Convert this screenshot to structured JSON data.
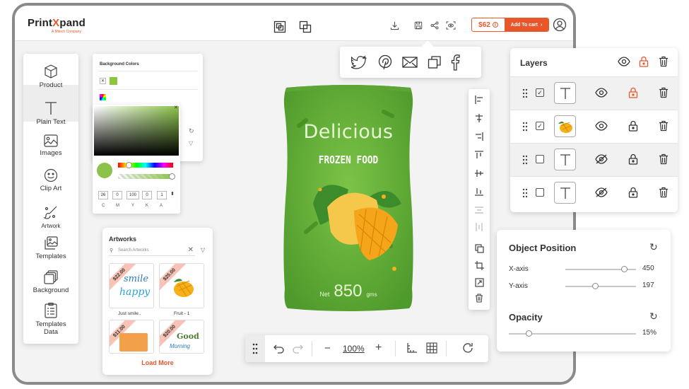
{
  "brand": {
    "name_part1": "Print",
    "name_part2": "X",
    "name_part3": "pand",
    "tagline": "A Mitech Company"
  },
  "header": {
    "price": "$62",
    "add_to_cart": "Add To cart"
  },
  "sidebar": {
    "items": [
      {
        "label": "Product",
        "icon": "cube-icon"
      },
      {
        "label": "Plain Text",
        "icon": "text-icon"
      },
      {
        "label": "Images",
        "icon": "image-icon"
      },
      {
        "label": "Clip Art",
        "icon": "smiley-icon"
      },
      {
        "label": "Artwork",
        "icon": "brush-icon"
      },
      {
        "label": "Templates",
        "icon": "templates-icon"
      },
      {
        "label": "Background",
        "icon": "background-icon"
      },
      {
        "label": "Templates",
        "label2": "Data",
        "icon": "list-icon"
      }
    ]
  },
  "color_panel": {
    "title": "Background Colors",
    "swatch": "#8cc63f",
    "current_color": "#8bc34a",
    "cmyk": {
      "c": "26",
      "m": "0",
      "y": "100",
      "k": "0",
      "a": "1"
    },
    "labels": {
      "c": "C",
      "m": "M",
      "y": "Y",
      "k": "K",
      "a": "A"
    }
  },
  "artworks": {
    "title": "Artworks",
    "search_placeholder": "Search Artworks",
    "items": [
      {
        "price": "$22.00",
        "name": "Just smile..",
        "art_line1": "smile",
        "art_line2": "happy"
      },
      {
        "price": "$25.00",
        "name": "Fruit - 1"
      },
      {
        "price": "$11.00",
        "name": ""
      },
      {
        "price": "$20.00",
        "name": "",
        "art_line1": "Good",
        "art_line2": "Morning"
      }
    ],
    "load_more": "Load More"
  },
  "product": {
    "title": "Delicious",
    "subtitle": "FROZEN FOOD",
    "net_label": "Net",
    "net_value": "850",
    "net_unit": "gms",
    "color": "#6bb83a"
  },
  "share_icons": [
    "twitter-icon",
    "pinterest-icon",
    "mail-icon",
    "copy-icon",
    "facebook-icon"
  ],
  "bottom_toolbar": {
    "zoom": "100%"
  },
  "layers": {
    "title": "Layers",
    "rows": [
      {
        "checked": true,
        "thumb": "text",
        "visible": true,
        "locked": true
      },
      {
        "checked": true,
        "thumb": "mango",
        "visible": true,
        "locked": false
      },
      {
        "checked": false,
        "thumb": "text",
        "visible": false,
        "locked": false
      },
      {
        "checked": false,
        "thumb": "text",
        "visible": false,
        "locked": false
      }
    ]
  },
  "object_position": {
    "title": "Object Position",
    "x_label": "X-axis",
    "x_value": "450",
    "y_label": "Y-axis",
    "y_value": "197",
    "opacity_title": "Opacity",
    "opacity_value": "15%"
  },
  "colors": {
    "accent": "#e8572a",
    "green": "#8bc34a"
  }
}
